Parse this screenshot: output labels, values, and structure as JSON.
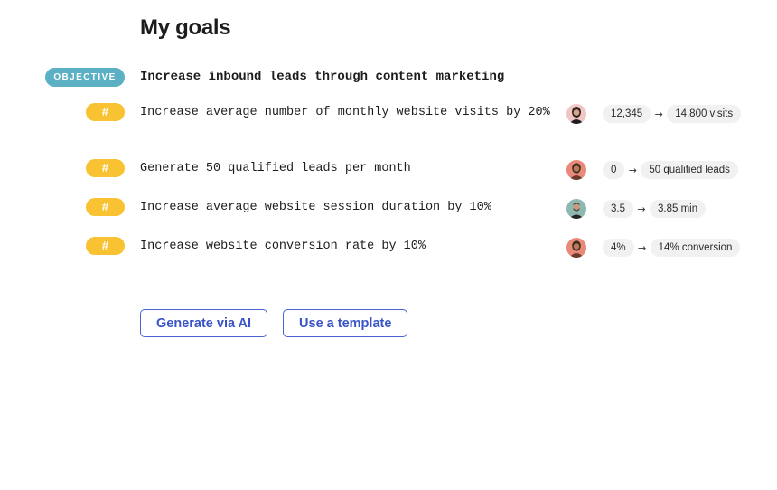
{
  "page": {
    "title": "My goals"
  },
  "objective": {
    "badge_label": "OBJECTIVE",
    "title": "Increase inbound leads through content marketing",
    "badge_color": "#5bb0c4"
  },
  "key_results": [
    {
      "badge_label": "#",
      "title": "Increase average number of monthly website visits by 20%",
      "owner_avatar": "avatar-woman-dark-hair",
      "start_value": "12,345",
      "target_value": "14,800 visits"
    },
    {
      "badge_label": "#",
      "title": "Generate 50 qualified leads per month",
      "owner_avatar": "avatar-woman-red-background",
      "start_value": "0",
      "target_value": "50 qualified leads"
    },
    {
      "badge_label": "#",
      "title": "Increase average website session duration by 10%",
      "owner_avatar": "avatar-man-bearded",
      "start_value": "3.5",
      "target_value": "3.85 min"
    },
    {
      "badge_label": "#",
      "title": "Increase website conversion rate by 10%",
      "owner_avatar": "avatar-woman-red-background",
      "start_value": "4%",
      "target_value": "14% conversion"
    }
  ],
  "actions": {
    "generate_label": "Generate via AI",
    "template_label": "Use a template"
  },
  "colors": {
    "key_result_badge": "#f8c232",
    "button_accent": "#4a64d4"
  }
}
